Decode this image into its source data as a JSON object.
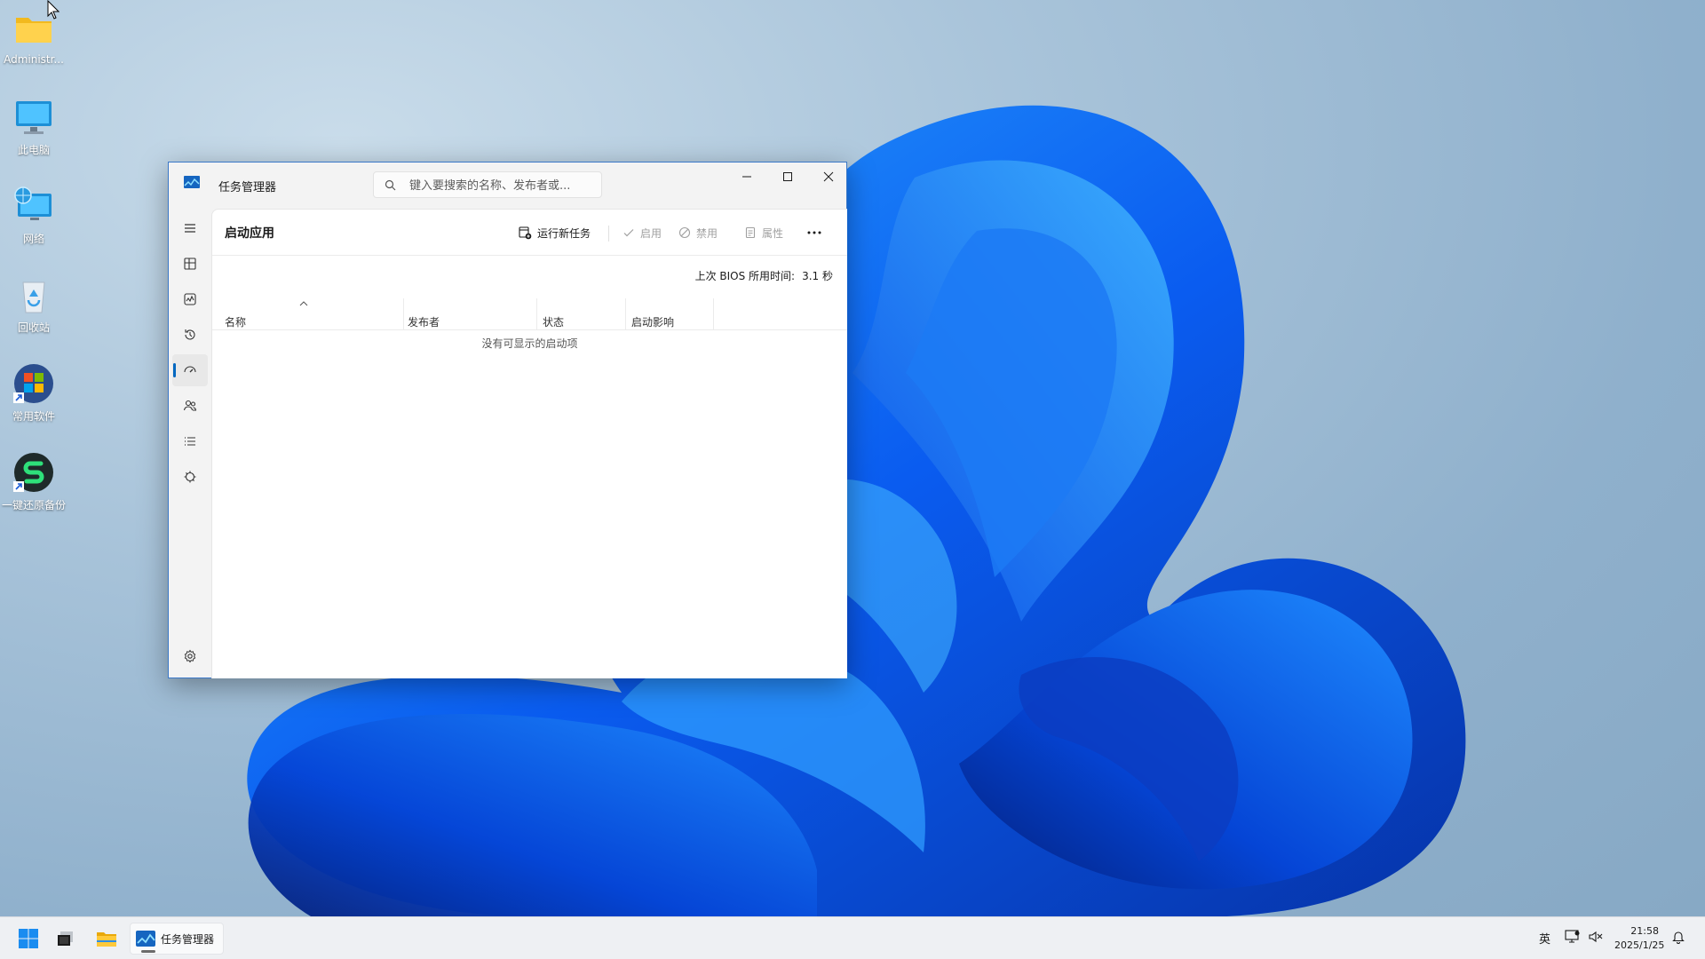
{
  "desktop": {
    "icons": [
      {
        "label": "Administr...",
        "icon": "folder-icon"
      },
      {
        "label": "此电脑",
        "icon": "computer-icon"
      },
      {
        "label": "网络",
        "icon": "network-icon"
      },
      {
        "label": "回收站",
        "icon": "recycle-bin-icon"
      },
      {
        "label": "常用软件",
        "icon": "software-shortcut-icon"
      },
      {
        "label": "一键还原备份",
        "icon": "restore-backup-icon"
      }
    ]
  },
  "window": {
    "title": "任务管理器",
    "search_placeholder": "键入要搜索的名称、发布者或...",
    "page_title": "启动应用",
    "toolbar": {
      "run_new_task": "运行新任务",
      "enable": "启用",
      "disable": "禁用",
      "properties": "属性"
    },
    "bios": {
      "label": "上次 BIOS 所用时间:",
      "value": "3.1 秒"
    },
    "columns": [
      "名称",
      "发布者",
      "状态",
      "启动影响"
    ],
    "empty_message": "没有可显示的启动项",
    "nav": [
      {
        "name": "menu-icon",
        "active": false
      },
      {
        "name": "processes-icon",
        "active": false
      },
      {
        "name": "performance-icon",
        "active": false
      },
      {
        "name": "app-history-icon",
        "active": false
      },
      {
        "name": "startup-apps-icon",
        "active": true
      },
      {
        "name": "users-icon",
        "active": false
      },
      {
        "name": "details-icon",
        "active": false
      },
      {
        "name": "services-icon",
        "active": false
      },
      {
        "name": "settings-icon",
        "active": false
      }
    ]
  },
  "taskbar": {
    "running_app": "任务管理器",
    "language": "英",
    "time": "21:58",
    "date": "2025/1/25"
  },
  "colors": {
    "accent": "#0067c0",
    "window_border": "#3a78c8"
  }
}
